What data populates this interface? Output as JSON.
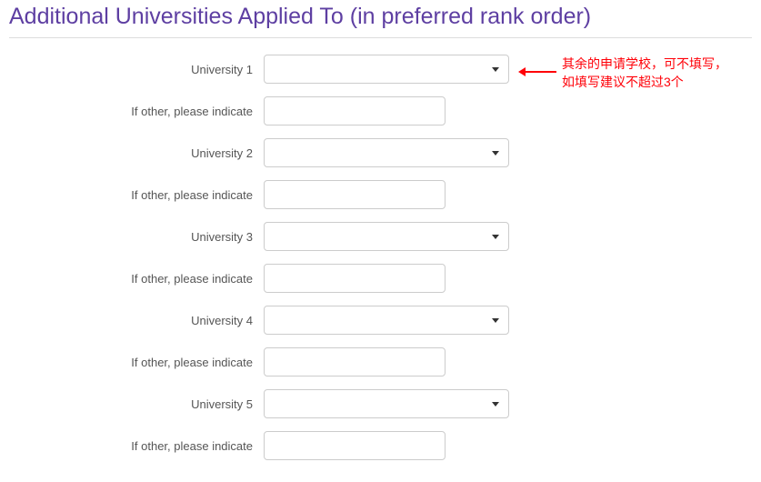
{
  "section_title": "Additional Universities Applied To (in preferred rank order)",
  "rows": [
    {
      "label": "University 1",
      "type": "select"
    },
    {
      "label": "If other, please indicate",
      "type": "text"
    },
    {
      "label": "University 2",
      "type": "select"
    },
    {
      "label": "If other, please indicate",
      "type": "text"
    },
    {
      "label": "University 3",
      "type": "select"
    },
    {
      "label": "If other, please indicate",
      "type": "text"
    },
    {
      "label": "University 4",
      "type": "select"
    },
    {
      "label": "If other, please indicate",
      "type": "text"
    },
    {
      "label": "University 5",
      "type": "select"
    },
    {
      "label": "If other, please indicate",
      "type": "text"
    }
  ],
  "annotation": {
    "line1": "其余的申请学校，可不填写，",
    "line2": "如填写建议不超过3个"
  }
}
